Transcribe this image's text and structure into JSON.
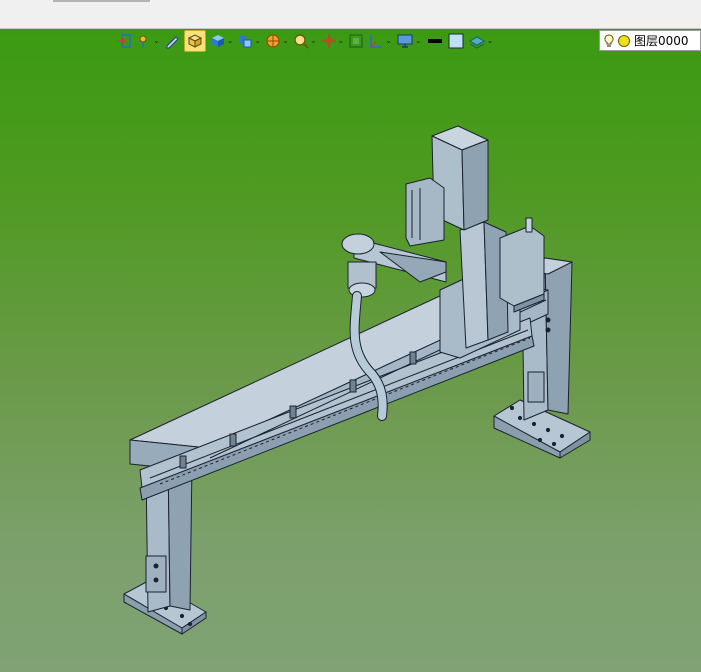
{
  "toolbar": {
    "layer_label": "图层0000",
    "icons": [
      "exit-sketch-icon",
      "point-icon",
      "pencil-icon",
      "view-box-icon",
      "cube-view-icon",
      "display-style-icon",
      "section-view-icon",
      "zoom-icon",
      "move-icon",
      "fit-view-icon",
      "triad-icon",
      "monitor-icon",
      "line-color-icon",
      "fill-color-icon",
      "layer-stack-icon",
      "bulb-icon",
      "layer-color-icon"
    ]
  },
  "colors": {
    "background_top": "#3b9a12",
    "background_bottom": "#80a274",
    "model_fill": "#a7b9c8",
    "model_edge": "#1a2230",
    "toolbar_bg": "#f0f0f0",
    "highlight": "#f6e27a"
  }
}
